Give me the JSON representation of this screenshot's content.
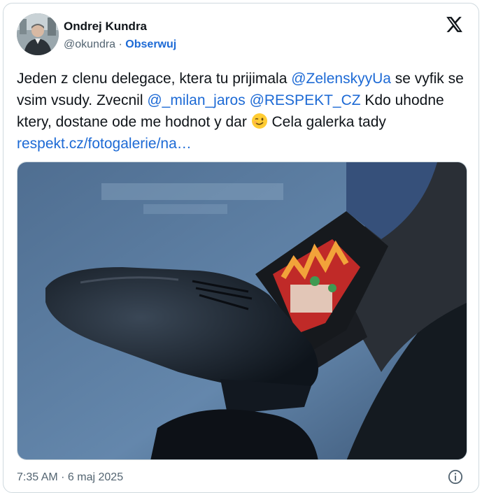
{
  "author": {
    "name": "Ondrej Kundra",
    "handle": "@okundra",
    "separator": "·",
    "follow_label": "Obserwuj"
  },
  "tweet": {
    "t1": "Jeden z clenu delegace, ktera tu prijimala ",
    "mention1": "@ZelenskyyUa",
    "t2": " se vyfik se vsim vsudy. Zvecnil ",
    "mention2": "@_milan_jaros",
    "mention3": "@RESPEKT_CZ",
    "t3": " Kdo uhodne ktery, dostane ode me hodnot y dar ",
    "t4": " Cela galerka tady ",
    "link": "respekt.cz/fotogalerie/na…"
  },
  "footer": {
    "timestamp": "7:35 AM · 6 maj 2025"
  },
  "icons": {
    "x_logo": "x-logo-icon",
    "info": "info-icon",
    "emoji": "winking-face-emoji"
  },
  "colors": {
    "link": "#1d6ad5",
    "text": "#0f1419",
    "muted": "#536471",
    "border": "#cfd9de"
  }
}
